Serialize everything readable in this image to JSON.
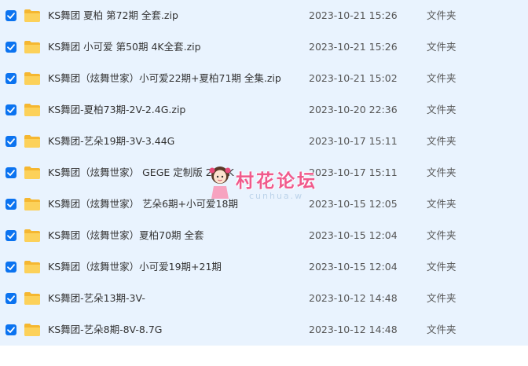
{
  "files": [
    {
      "name": "KS舞团 夏柏 第72期 全套.zip",
      "modified": "2023-10-21 15:26",
      "type": "文件夹",
      "checked": true
    },
    {
      "name": "KS舞团 小可爱 第50期 4K全套.zip",
      "modified": "2023-10-21 15:26",
      "type": "文件夹",
      "checked": true
    },
    {
      "name": "KS舞团（炫舞世家）小可爱22期+夏柏71期 全集.zip",
      "modified": "2023-10-21 15:02",
      "type": "文件夹",
      "checked": true
    },
    {
      "name": "KS舞团-夏柏73期-2V-2.4G.zip",
      "modified": "2023-10-20 22:36",
      "type": "文件夹",
      "checked": true
    },
    {
      "name": "KS舞团-艺朵19期-3V-3.44G",
      "modified": "2023-10-17 15:11",
      "type": "文件夹",
      "checked": true
    },
    {
      "name": "KS舞团（炫舞世家） GEGE 定制版 24.4K",
      "modified": "2023-10-17 15:11",
      "type": "文件夹",
      "checked": true
    },
    {
      "name": "KS舞团（炫舞世家） 艺朵6期+小可爱18期",
      "modified": "2023-10-15 12:05",
      "type": "文件夹",
      "checked": true
    },
    {
      "name": "KS舞团（炫舞世家）夏柏70期 全套",
      "modified": "2023-10-15 12:04",
      "type": "文件夹",
      "checked": true
    },
    {
      "name": "KS舞团（炫舞世家）小可爱19期+21期",
      "modified": "2023-10-15 12:04",
      "type": "文件夹",
      "checked": true
    },
    {
      "name": "KS舞团-艺朵13期-3V-",
      "modified": "2023-10-12 14:48",
      "type": "文件夹",
      "checked": true
    },
    {
      "name": "KS舞团-艺朵8期-8V-8.7G",
      "modified": "2023-10-12 14:48",
      "type": "文件夹",
      "checked": true
    }
  ],
  "watermark": {
    "text": "村花论坛",
    "subtext": "cunhua.w"
  },
  "colors": {
    "row_selected_bg": "#e9f3fe",
    "checkbox": "#0b73f0",
    "folder": "#f7c74b",
    "watermark": "#f05a8c"
  },
  "icons": {
    "checkbox": "checkmark-icon",
    "folder": "folder-icon"
  }
}
